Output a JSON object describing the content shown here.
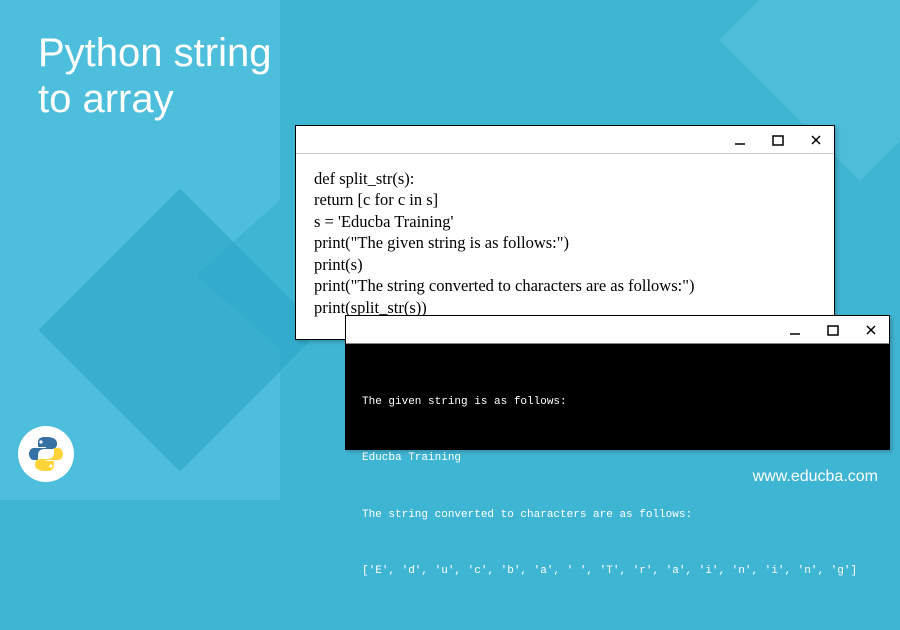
{
  "title_line1": "Python string",
  "title_line2": "to array",
  "url": "www.educba.com",
  "code": {
    "l1": "def split_str(s):",
    "l2": "return [c for c in s]",
    "l3": "s = 'Educba Training'",
    "l4": "print(\"The given string is as follows:\")",
    "l5": "print(s)",
    "l6": "print(\"The string converted to characters are as follows:\")",
    "l7": "print(split_str(s))"
  },
  "output": {
    "l1": "The given string is as follows:",
    "l2": "Educba Training",
    "l3": "The string converted to characters are as follows:",
    "l4": "['E', 'd', 'u', 'c', 'b', 'a', ' ', 'T', 'r', 'a', 'i', 'n', 'i', 'n', 'g']"
  },
  "icons": {
    "minimize": "minimize-icon",
    "maximize": "maximize-icon",
    "close": "close-icon"
  }
}
